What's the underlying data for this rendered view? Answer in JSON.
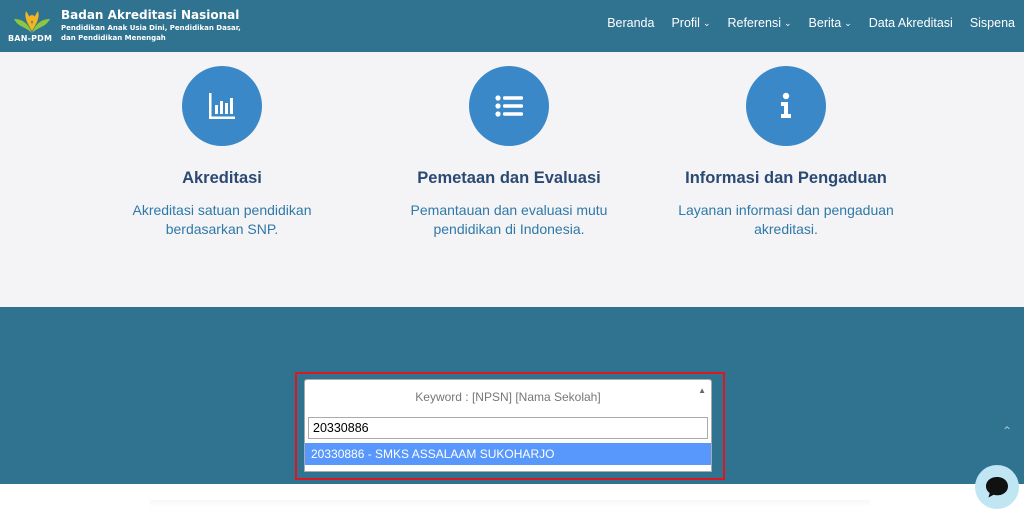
{
  "header": {
    "logo_text": "BAN-PDM",
    "title": "Badan Akreditasi Nasional",
    "subtitle": "Pendidikan Anak Usia Dini, Pendidikan Dasar, dan Pendidikan Menengah",
    "nav": [
      {
        "label": "Beranda",
        "has_dropdown": false
      },
      {
        "label": "Profil",
        "has_dropdown": true
      },
      {
        "label": "Referensi",
        "has_dropdown": true
      },
      {
        "label": "Berita",
        "has_dropdown": true
      },
      {
        "label": "Data Akreditasi",
        "has_dropdown": false
      },
      {
        "label": "Sispena",
        "has_dropdown": false
      }
    ]
  },
  "features": [
    {
      "icon": "bar-chart-icon",
      "title": "Akreditasi",
      "description": "Akreditasi satuan pendidikan berdasarkan SNP."
    },
    {
      "icon": "list-icon",
      "title": "Pemetaan dan Evaluasi",
      "description": "Pemantauan dan evaluasi mutu pendidikan di Indonesia."
    },
    {
      "icon": "info-icon",
      "title": "Informasi dan Pengaduan",
      "description": "Layanan informasi dan pengaduan akreditasi."
    }
  ],
  "search": {
    "placeholder": "Keyword : [NPSN] [Nama Sekolah]",
    "query": "20330886",
    "results": [
      "20330886 - SMKS ASSALAAM SUKOHARJO"
    ]
  },
  "colors": {
    "header_bg": "#2f7390",
    "accent_circle": "#3a88c8",
    "highlight_result": "#5897fb",
    "annotation_border": "#e0161e"
  }
}
